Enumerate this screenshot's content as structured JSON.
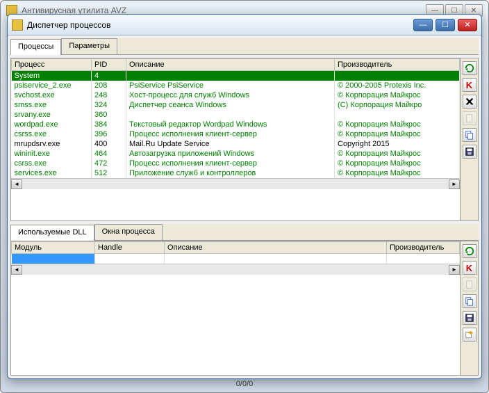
{
  "parent_window": {
    "title": "Антивирусная утилита AVZ"
  },
  "window": {
    "title": "Диспетчер процессов"
  },
  "status_text": "0/0/0",
  "top_tabs": [
    {
      "label": "Процессы",
      "active": true
    },
    {
      "label": "Параметры",
      "active": false
    }
  ],
  "process_columns": {
    "name": "Процесс",
    "pid": "PID",
    "desc": "Описание",
    "vendor": "Производитель"
  },
  "processes": [
    {
      "name": "System",
      "pid": "4",
      "desc": "",
      "vendor": "",
      "cls": "selected"
    },
    {
      "name": "psiservice_2.exe",
      "pid": "208",
      "desc": "PsiService PsiService",
      "vendor": "© 2000-2005 Protexis Inc.",
      "cls": "trusted"
    },
    {
      "name": "svchost.exe",
      "pid": "248",
      "desc": "Хост-процесс для служб Windows",
      "vendor": "© Корпорация Майкрос",
      "cls": "trusted"
    },
    {
      "name": "smss.exe",
      "pid": "324",
      "desc": "Диспетчер сеанса Windows",
      "vendor": "(C) Корпорация Майкро",
      "cls": "trusted"
    },
    {
      "name": "srvany.exe",
      "pid": "360",
      "desc": "",
      "vendor": "",
      "cls": "trusted"
    },
    {
      "name": "wordpad.exe",
      "pid": "384",
      "desc": "Текстовый редактор Wordpad Windows",
      "vendor": "© Корпорация Майкрос",
      "cls": "trusted"
    },
    {
      "name": "csrss.exe",
      "pid": "396",
      "desc": "Процесс исполнения клиент-сервер",
      "vendor": "© Корпорация Майкрос",
      "cls": "trusted"
    },
    {
      "name": "mrupdsrv.exe",
      "pid": "400",
      "desc": "Mail.Ru Update Service",
      "vendor": "Copyright 2015",
      "cls": "normal"
    },
    {
      "name": "wininit.exe",
      "pid": "464",
      "desc": "Автозагрузка приложений Windows",
      "vendor": "© Корпорация Майкрос",
      "cls": "trusted"
    },
    {
      "name": "csrss.exe",
      "pid": "472",
      "desc": "Процесс исполнения клиент-сервер",
      "vendor": "© Корпорация Майкрос",
      "cls": "trusted"
    },
    {
      "name": "services.exe",
      "pid": "512",
      "desc": "Приложение служб и контроллеров",
      "vendor": "© Корпорация Майкрос",
      "cls": "trusted"
    }
  ],
  "bottom_tabs": [
    {
      "label": "Используемые DLL",
      "active": true
    },
    {
      "label": "Окна процесса",
      "active": false
    }
  ],
  "dll_columns": {
    "module": "Модуль",
    "handle": "Handle",
    "desc": "Описание",
    "vendor": "Производитель"
  },
  "dll_rows": [
    {
      "module": "",
      "handle": "",
      "desc": "",
      "vendor": "",
      "cls": "dll-selected"
    }
  ],
  "sidebar_top": [
    {
      "name": "refresh-icon",
      "glyph": "refresh",
      "color": "#008000",
      "dim": false
    },
    {
      "name": "kaspersky-icon",
      "glyph": "K",
      "color": "#c00000",
      "dim": false
    },
    {
      "name": "kill-icon",
      "glyph": "X",
      "color": "#000",
      "dim": false
    },
    {
      "name": "doc-icon",
      "glyph": "doc",
      "color": "#888",
      "dim": true
    },
    {
      "name": "copy-icon",
      "glyph": "copy",
      "color": "#3060c0",
      "dim": false
    },
    {
      "name": "save-icon",
      "glyph": "save",
      "color": "#000",
      "dim": false
    }
  ],
  "sidebar_bottom": [
    {
      "name": "refresh-icon",
      "glyph": "refresh",
      "color": "#008000",
      "dim": false
    },
    {
      "name": "kaspersky-icon",
      "glyph": "K",
      "color": "#c00000",
      "dim": false
    },
    {
      "name": "doc-icon",
      "glyph": "doc",
      "color": "#888",
      "dim": true
    },
    {
      "name": "copy-icon",
      "glyph": "copy",
      "color": "#3060c0",
      "dim": false
    },
    {
      "name": "save-icon",
      "glyph": "save",
      "color": "#000",
      "dim": false
    },
    {
      "name": "export-icon",
      "glyph": "export",
      "color": "#e0a000",
      "dim": false
    }
  ]
}
